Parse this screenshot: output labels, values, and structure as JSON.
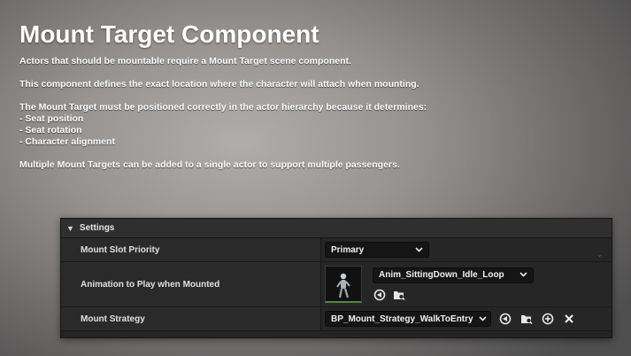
{
  "doc": {
    "title": "Mount Target Component",
    "p1": "Actors that should be mountable require a Mount Target scene component.",
    "p2": "This component defines the exact location where the character will attach when mounting.",
    "p3": "The Mount Target must be positioned correctly in the actor hierarchy because it determines:",
    "list": [
      "Seat position",
      "Seat rotation",
      "Character alignment"
    ],
    "p4": "Multiple Mount Targets can be added to a single actor to support multiple passengers."
  },
  "panel": {
    "section_label": "Settings",
    "rows": [
      {
        "label": "Mount Slot Priority",
        "value": "Primary"
      },
      {
        "label": "Animation to Play when Mounted",
        "value": "Anim_SittingDown_Idle_Loop"
      },
      {
        "label": "Mount Strategy",
        "value": "BP_Mount_Strategy_WalkToEntry"
      }
    ]
  },
  "icons": {
    "section_toggle": "triangle-down-icon",
    "dropdown": "chevron-down-icon",
    "use_selected": "use-selected-arrow-icon",
    "browse": "browse-folder-icon",
    "add": "plus-circle-icon",
    "clear": "x-icon"
  },
  "colors": {
    "panel_bg": "#242424",
    "combo_bg": "#151515",
    "thumb_accent": "#4e8e3a"
  }
}
